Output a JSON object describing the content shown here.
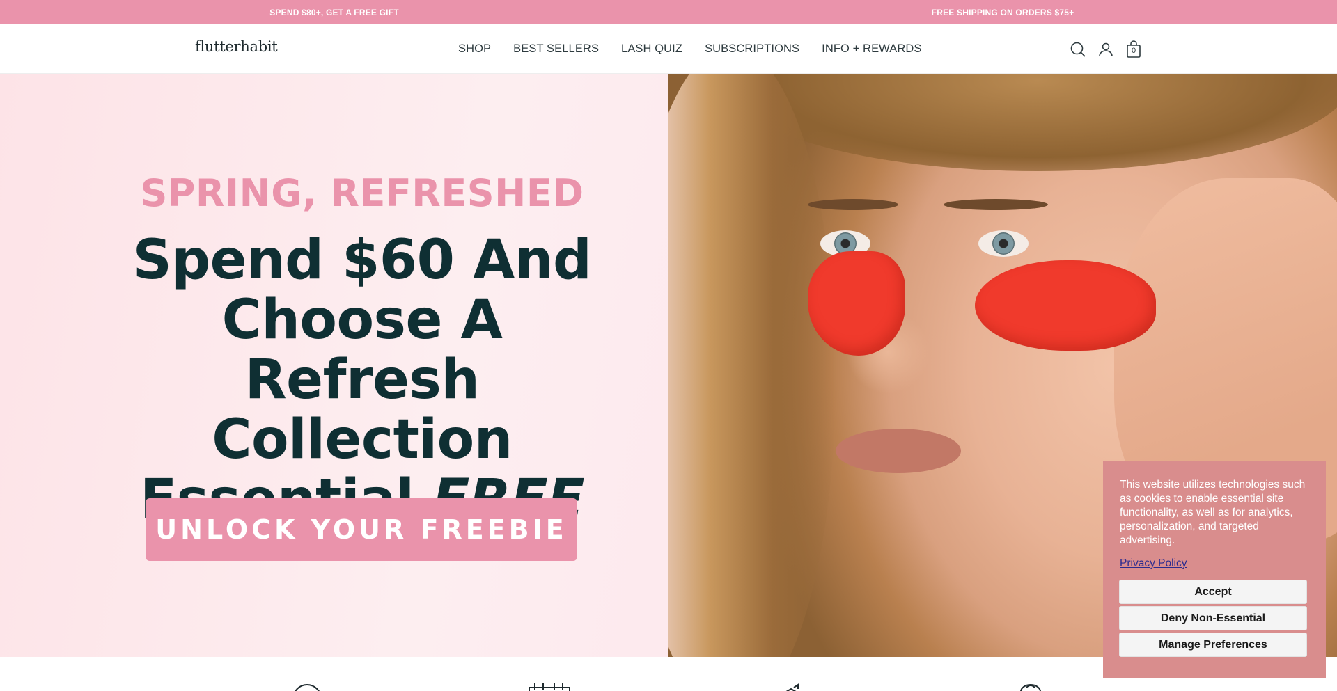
{
  "announcement": {
    "left": "SPEND $80+, GET A FREE GIFT",
    "right": "FREE SHIPPING ON ORDERS $75+"
  },
  "header": {
    "logo": "flutterhabit",
    "nav": [
      "SHOP",
      "BEST SELLERS",
      "LASH QUIZ",
      "SUBSCRIPTIONS",
      "INFO + REWARDS"
    ],
    "cart_count": "0",
    "icons": [
      "search-icon",
      "account-icon",
      "cart-bag-icon"
    ]
  },
  "hero": {
    "kicker": "SPRING, REFRESHED",
    "headline_line1": "Spend $60 And",
    "headline_line2": "Choose A Refresh",
    "headline_line3": "Collection",
    "headline_line4_plain": "Essential ",
    "headline_line4_emph": "FREE",
    "cta": "UNLOCK YOUR FREEBIE",
    "background_color": "#fde3e7",
    "accent_color": "#ea93ab",
    "text_color": "#0f2f33"
  },
  "features": {
    "icons": [
      "clock-icon",
      "calendar-icon",
      "box-arrow-icon",
      "gift-icon"
    ]
  },
  "cookie_banner": {
    "text": "This website utilizes technologies such as cookies to enable essential site functionality, as well as for analytics, personalization, and targeted advertising.",
    "privacy_link": "Privacy Policy",
    "accept": "Accept",
    "deny": "Deny Non-Essential",
    "manage": "Manage Preferences",
    "background_color": "#d98d8d"
  }
}
